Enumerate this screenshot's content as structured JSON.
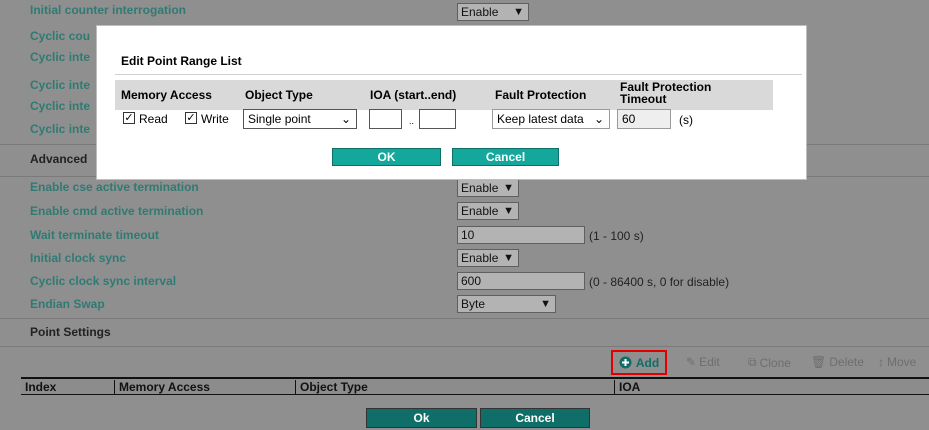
{
  "colors": {
    "accent": "#14a89d",
    "label": "#2f7b74",
    "overlay": "#8f8f8f",
    "highlight": "#e00000"
  },
  "settings": {
    "initial_counter_label": "Initial counter interrogation",
    "initial_counter_value": "Enable",
    "cyclic_labels": [
      "Cyclic cou",
      "Cyclic inte",
      "Cyclic inte",
      "Cyclic inte",
      "Cyclic inte"
    ],
    "advanced_label": "Advanced",
    "cse_label": "Enable cse active termination",
    "cse_value": "Enable",
    "cmd_label": "Enable cmd active termination",
    "cmd_value": "Enable",
    "wait_label": "Wait terminate timeout",
    "wait_value": "10",
    "wait_hint": "(1 - 100 s)",
    "clock_label": "Initial clock sync",
    "clock_value": "Enable",
    "cyclic_clock_label": "Cyclic clock sync interval",
    "cyclic_clock_value": "600",
    "cyclic_clock_hint": "(0 - 86400 s, 0 for disable)",
    "endian_label": "Endian Swap",
    "endian_value": "Byte"
  },
  "point_settings": {
    "title": "Point Settings",
    "toolbar": {
      "add": "Add",
      "edit": "Edit",
      "clone": "Clone",
      "delete": "Delete",
      "move": "Move"
    },
    "columns": [
      "Index",
      "Memory Access",
      "Object Type",
      "IOA"
    ]
  },
  "footer": {
    "ok": "Ok",
    "cancel": "Cancel"
  },
  "modal": {
    "title": "Edit Point Range List",
    "headers": {
      "memory_access": "Memory Access",
      "object_type": "Object Type",
      "ioa": "IOA (start..end)",
      "fault_protection": "Fault Protection",
      "fault_timeout": "Fault Protection Timeout"
    },
    "read_label": "Read",
    "read_checked": true,
    "write_label": "Write",
    "write_checked": true,
    "object_type_value": "Single point",
    "ioa_start": "",
    "ioa_sep": "..",
    "ioa_end": "",
    "fault_protection_value": "Keep latest data",
    "timeout_value": "60",
    "timeout_unit": "(s)",
    "ok": "OK",
    "cancel": "Cancel"
  }
}
